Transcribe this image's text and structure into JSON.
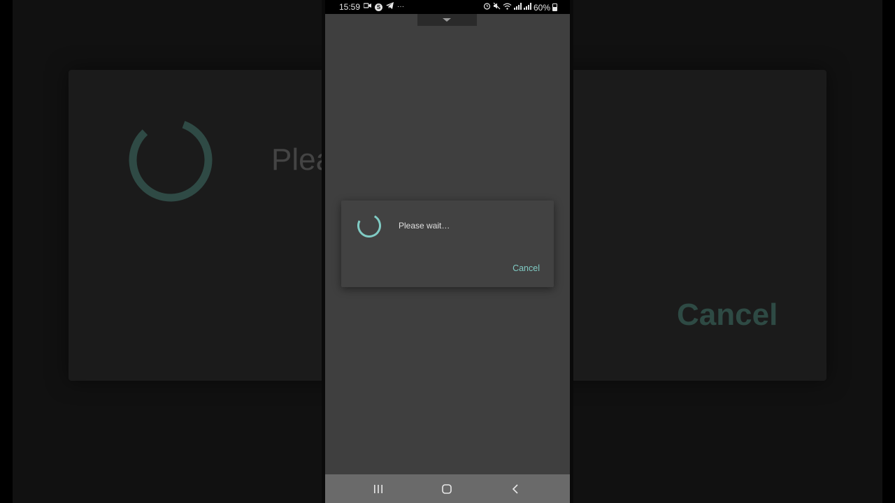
{
  "status_bar": {
    "time": "15:59",
    "battery": "60%",
    "left_icons": [
      "video-icon",
      "skype-icon",
      "telegram-icon",
      "more-icon"
    ],
    "right_icons": [
      "alarm-icon",
      "mute-icon",
      "wifi-icon",
      "signal-icon",
      "signal-icon",
      "battery-icon"
    ]
  },
  "dialog": {
    "message": "Please wait…",
    "cancel_label": "Cancel"
  },
  "background": {
    "message_fragment": "Plea",
    "cancel_label": "Cancel"
  },
  "colors": {
    "accent": "#80cbc4",
    "dialog_bg": "#424242",
    "screen_bg": "#3f3f3f",
    "nav_bar": "#6a6a6a"
  }
}
